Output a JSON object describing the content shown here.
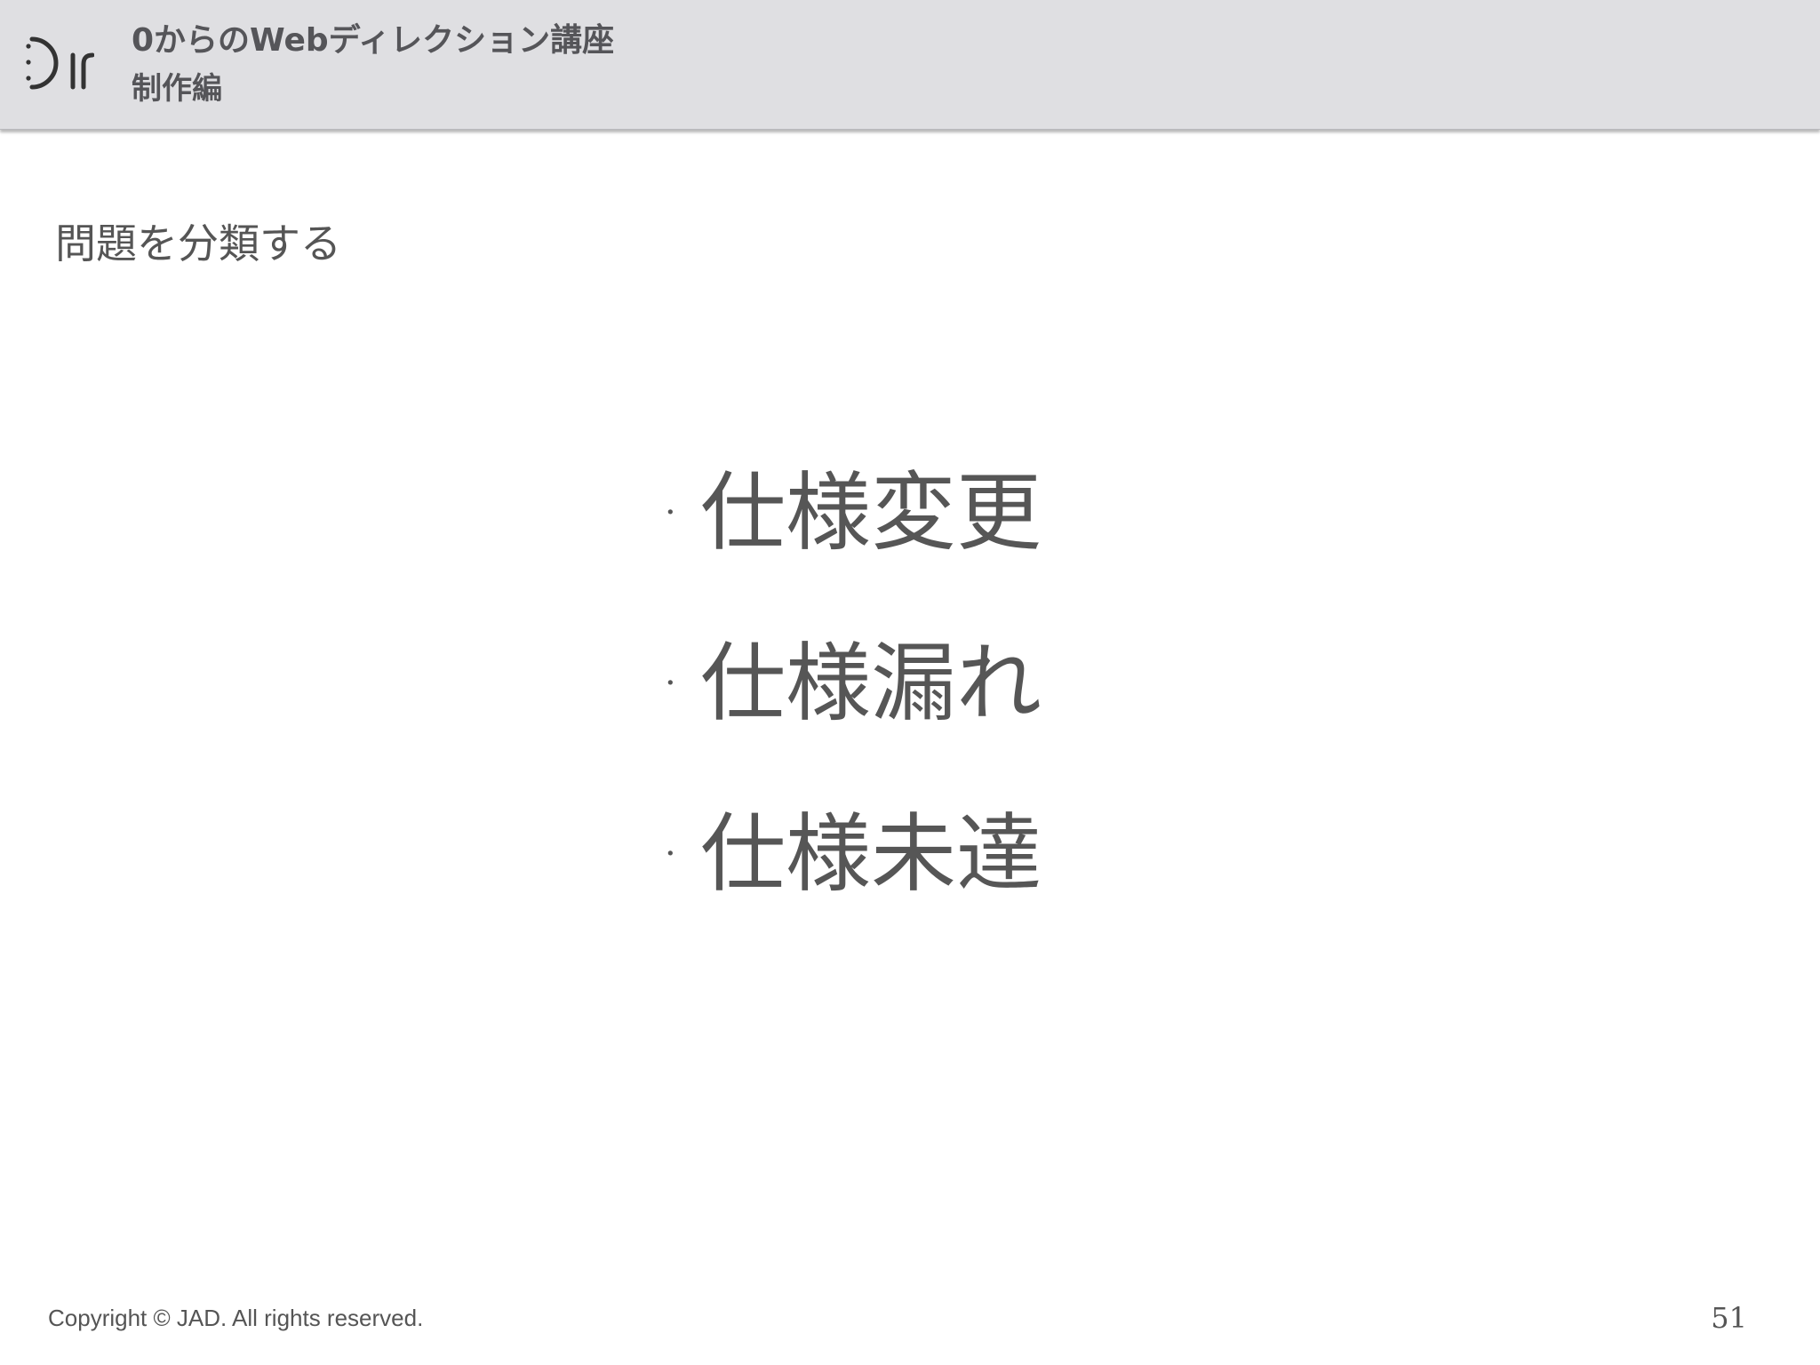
{
  "header": {
    "title": "0からのWebディレクション講座",
    "subtitle": "制作編",
    "logo_icon": "dir-logo-icon"
  },
  "slide": {
    "section_title": "問題を分類する",
    "bullet_marker": "·",
    "items": [
      {
        "label": "仕様変更"
      },
      {
        "label": "仕様漏れ"
      },
      {
        "label": "仕様未達"
      }
    ]
  },
  "footer": {
    "copyright": "Copyright © JAD. All rights reserved.",
    "page_number": "51"
  },
  "colors": {
    "header_bg": "#dfdfe2",
    "text": "#555555",
    "background": "#ffffff"
  }
}
